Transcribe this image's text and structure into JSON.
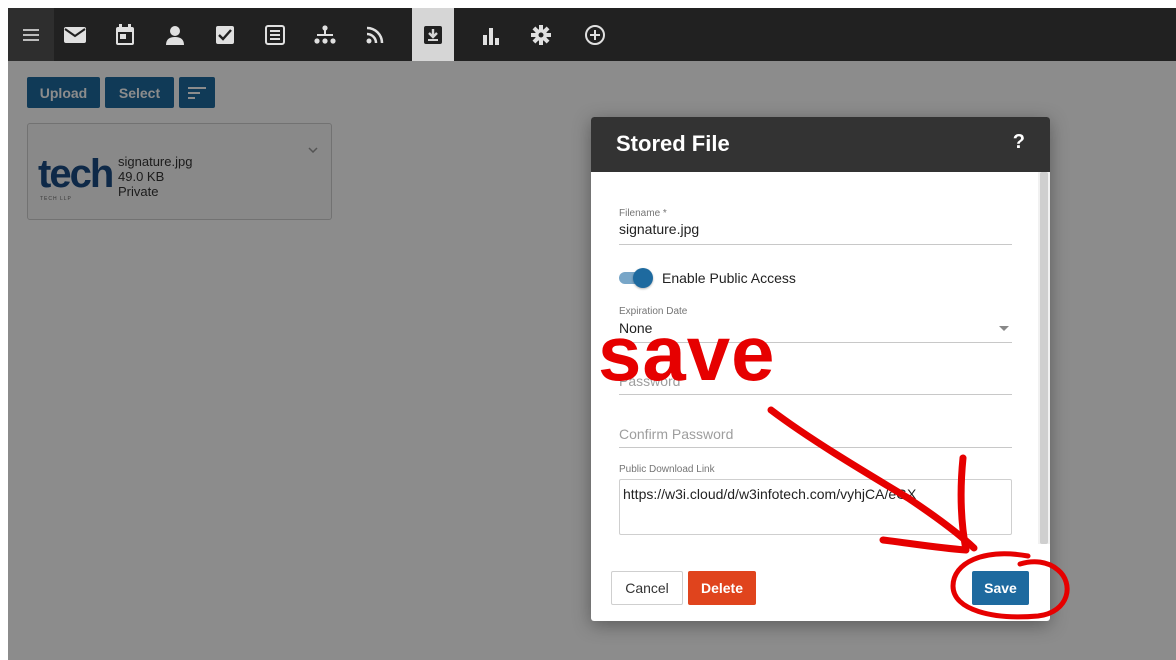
{
  "nav": {
    "icons": [
      "hamburger-icon",
      "mail-icon",
      "calendar-icon",
      "contact-icon",
      "task-icon",
      "notes-icon",
      "sitemap-icon",
      "rss-icon",
      "file-storage-icon",
      "analytics-icon",
      "settings-icon",
      "add-icon"
    ],
    "active": "file-storage-icon"
  },
  "toolbar": {
    "upload_label": "Upload",
    "select_label": "Select"
  },
  "file_card": {
    "filename": "signature.jpg",
    "size": "49.0 KB",
    "visibility": "Private",
    "thumb_word": "tech",
    "thumb_sub": "TECH LLP"
  },
  "dialog": {
    "title": "Stored File",
    "help": "?",
    "filename_label": "Filename *",
    "filename_value": "signature.jpg",
    "public_access_label": "Enable Public Access",
    "public_access_on": true,
    "expiration_label": "Expiration Date",
    "expiration_value": "None",
    "password_placeholder": "Password",
    "confirm_password_placeholder": "Confirm Password",
    "link_label": "Public Download Link",
    "link_value": "https://w3i.cloud/d/w3infotech.com/vyhjCA/eGX",
    "cancel_label": "Cancel",
    "delete_label": "Delete",
    "save_label": "Save"
  },
  "annotation": {
    "text": "save",
    "color": "#e60000"
  },
  "colors": {
    "accent": "#1e6a9f",
    "danger": "#e0441d",
    "nav_bg": "#212121"
  }
}
